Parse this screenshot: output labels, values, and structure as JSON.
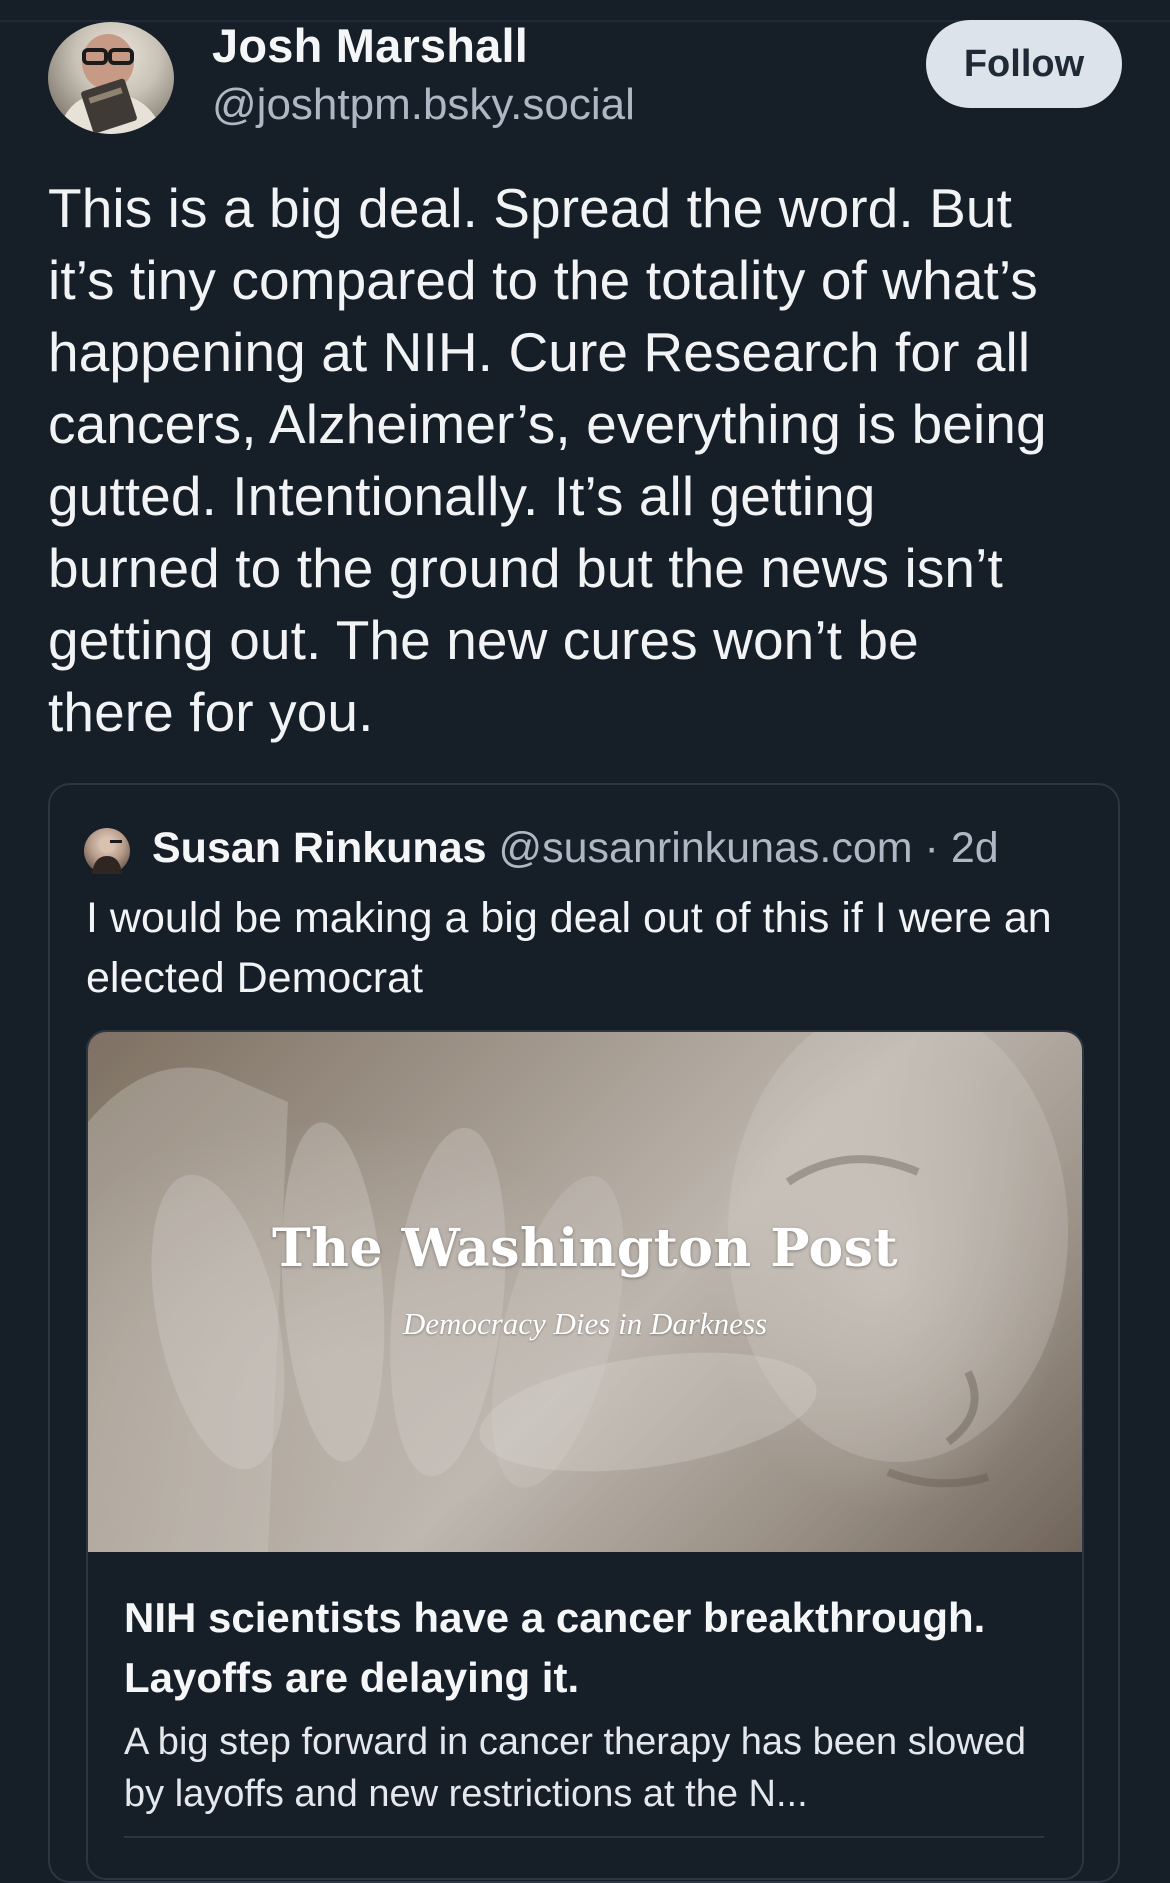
{
  "post": {
    "author": {
      "display_name": "Josh Marshall",
      "handle": "@joshtpm.bsky.social"
    },
    "follow_label": "Follow",
    "text": "This is a big deal. Spread the word. But\nit’s tiny compared to the totality of what’s\nhappening at NIH. Cure Research for all\ncancers, Alzheimer’s, everything is being\ngutted. Intentionally. It’s all getting\nburned to the ground but the news isn’t\ngetting out. The new cures won’t be\nthere for you."
  },
  "quote": {
    "author_name": "Susan Rinkunas",
    "author_handle": "@susanrinkunas.com",
    "time": "· 2d",
    "text": "I would be making a big deal out of this if I were an elected Democrat",
    "link_card": {
      "logo_text": "The Washington Post",
      "tagline": "Democracy Dies in Darkness",
      "title": "NIH scientists have a cancer breakthrough. Layoffs are delaying it.",
      "description": "A big step forward in cancer therapy has been slowed by layoffs and new restrictions at the N..."
    }
  },
  "colors": {
    "background": "#161e27",
    "text_primary": "#f1f3f5",
    "text_secondary": "#aeb8c4",
    "follow_bg": "#dde3ea",
    "border": "#2b3642"
  }
}
